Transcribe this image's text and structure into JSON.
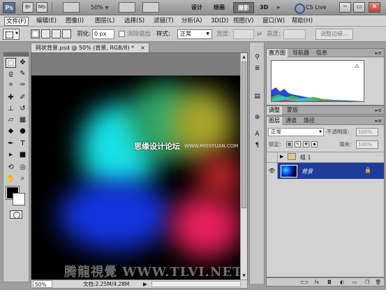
{
  "titlebar": {
    "app_logo": "Ps",
    "bridge_label": "Br",
    "minibridge_label": "Mb",
    "zoom_value": "50%",
    "workspaces": [
      "设计",
      "绘画",
      "摄影",
      "3D"
    ],
    "active_workspace": "摄影",
    "more": "»",
    "cslive_label": "CS Live",
    "minimize": "─",
    "restore": "▭",
    "close": "✕"
  },
  "menubar": {
    "items": [
      "文件(F)",
      "编辑(E)",
      "图像(I)",
      "图层(L)",
      "选择(S)",
      "滤镜(T)",
      "分析(A)",
      "3D(D)",
      "视图(V)",
      "窗口(W)",
      "帮助(H)"
    ],
    "active_index": 0
  },
  "options": {
    "feather_label": "羽化:",
    "feather_value": "0 px",
    "antialias_label": "消除锯齿",
    "style_label": "样式:",
    "style_value": "正常",
    "width_label": "宽度:",
    "height_label": "高度:",
    "refine_edge_label": "调整边缘..."
  },
  "document": {
    "tab_title": "网状背景.psd @ 50% (背景, RGB/8) *",
    "tab_close": "×",
    "watermark_text": "思缘设计论坛",
    "watermark_site": "WWW.MISSYUAN.COM",
    "bottom_watermark": "腾龍視覺 WWW.TLVI.NET",
    "colors": {
      "canvas_bg": "#000000",
      "cyan": "#17e3e6",
      "blue": "#1434e0",
      "green": "#2da86a",
      "yellow": "#a8a52c",
      "magenta": "#e8205c",
      "red": "#c0262a"
    }
  },
  "statusbar": {
    "zoom": "50%",
    "doc_info": "文档:2.25M/4.28M",
    "arrow": "▶"
  },
  "panels": {
    "histogram": {
      "tabs": [
        "直方图",
        "导航器",
        "信息"
      ],
      "active_tab": "直方图",
      "warning_icon": "⚠"
    },
    "adjustments": {
      "tabs": [
        "调整",
        "蒙版"
      ],
      "active_tab": "调整"
    },
    "layers": {
      "tabs": [
        "图层",
        "通道",
        "路径"
      ],
      "active_tab": "图层",
      "blend_mode": "正常",
      "opacity_label": "不透明度:",
      "opacity_value": "100%",
      "lock_label": "锁定:",
      "fill_label": "填充:",
      "fill_value": "100%",
      "layers": [
        {
          "name": "组 1",
          "type": "group",
          "visible": false,
          "selected": false
        },
        {
          "name": "背景",
          "type": "image",
          "visible": true,
          "selected": true
        }
      ],
      "bottom_icons": [
        "link-icon",
        "fx-icon",
        "mask-icon",
        "adjustment-icon",
        "folder-icon",
        "new-layer-icon",
        "trash-icon"
      ]
    }
  },
  "icons": {
    "marquee": "⬚",
    "move": "✥",
    "lasso": "ϱ",
    "quick-select": "✎",
    "crop": "⌗",
    "eyedropper": "✑",
    "heal": "✚",
    "brush": "✐",
    "stamp": "⊥",
    "history-brush": "↺",
    "eraser": "▱",
    "gradient": "▦",
    "blur": "◆",
    "dodge": "●",
    "pen": "✒",
    "type": "T",
    "path-select": "▸",
    "shape": "■",
    "3d-rotate": "⟲",
    "3d-orbit": "◎",
    "hand": "✋",
    "zoom": "⌕"
  }
}
